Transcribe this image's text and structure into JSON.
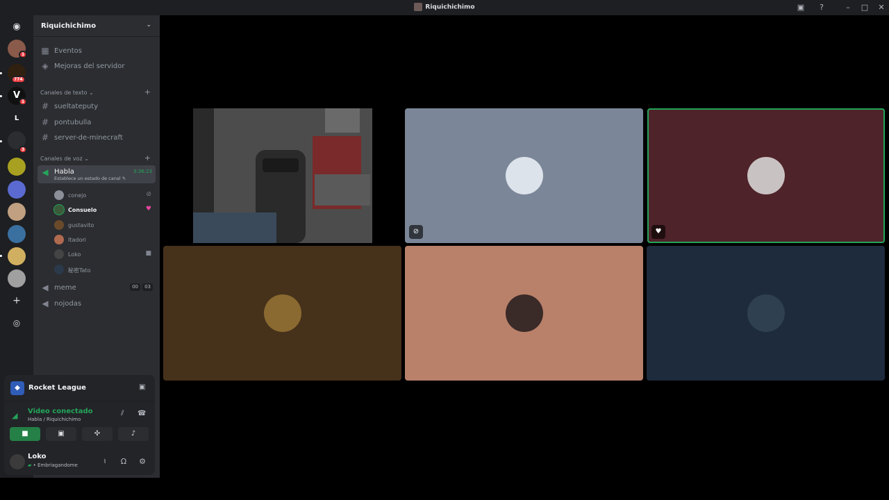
{
  "window": {
    "title": "Riquichichimo"
  },
  "rail": {
    "badges": [
      "1",
      "774",
      "1",
      "3"
    ],
    "letter_server": "L"
  },
  "guild": {
    "name": "Riquichichimo"
  },
  "menu": [
    {
      "label": "Eventos"
    },
    {
      "label": "Mejoras del servidor"
    }
  ],
  "text_category": {
    "label": "Canales de texto"
  },
  "text_channels": [
    {
      "label": "sueltateputy"
    },
    {
      "label": "pontubulla"
    },
    {
      "label": "server-de-minecraft"
    }
  ],
  "voice_category": {
    "label": "Canales de voz"
  },
  "active_voice": {
    "label": "Habla",
    "timer": "3:36:23",
    "status_prompt": "Establece un estado de canal"
  },
  "voice_users": [
    {
      "name": "conejo",
      "color": "#8a8f98"
    },
    {
      "name": "Consuelo",
      "color": "#3a5a3a"
    },
    {
      "name": "gustavito",
      "color": "#6a4a2a"
    },
    {
      "name": "Itadori",
      "color": "#b06a50"
    },
    {
      "name": "Loko",
      "color": "#444"
    },
    {
      "name": "秘密Tato",
      "color": "#2a3a4a"
    }
  ],
  "voice_channels": [
    {
      "label": "meme",
      "counts": [
        "00",
        "03"
      ]
    },
    {
      "label": "nojodas"
    }
  ],
  "game": {
    "name": "Rocket League"
  },
  "rtc": {
    "status": "Video conectado",
    "channel": "Habla / Riquichichimo"
  },
  "user": {
    "name": "Loko",
    "status": "• Embriagandome"
  },
  "tiles": [
    {
      "bg": "#4a4a4a"
    },
    {
      "bg": "#7b8799"
    },
    {
      "bg": "#4e2329"
    },
    {
      "bg": "#46311b"
    },
    {
      "bg": "#b9816a"
    },
    {
      "bg": "#1e2b3c"
    }
  ]
}
